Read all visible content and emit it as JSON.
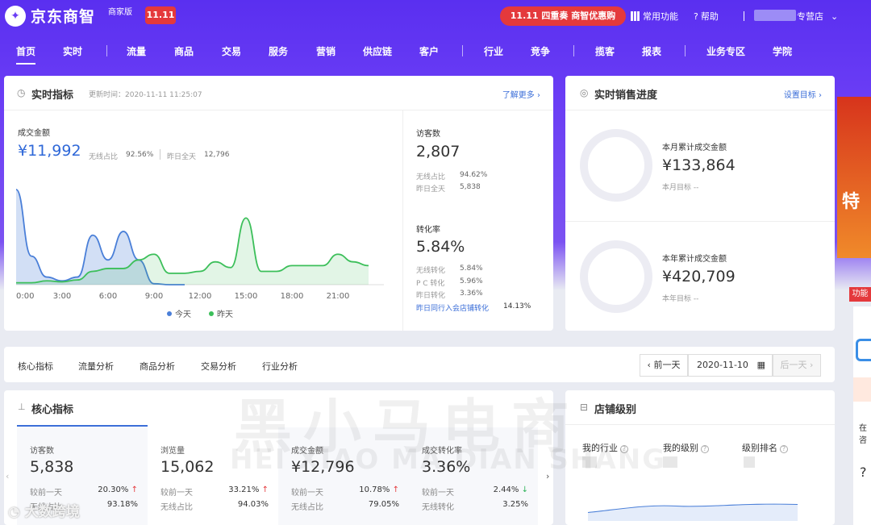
{
  "header": {
    "logo_text": "京东商智",
    "edition": "商家版",
    "badge_1111": "11.11",
    "promo": "11.11 四重奏 商智优惠购",
    "common_functions": "常用功能",
    "help": "帮助",
    "store_suffix": "专营店"
  },
  "nav": {
    "items": [
      "首页",
      "实时",
      "流量",
      "商品",
      "交易",
      "服务",
      "营销",
      "供应链",
      "客户",
      "行业",
      "竞争",
      "揽客",
      "报表",
      "业务专区",
      "学院"
    ]
  },
  "realtime": {
    "title": "实时指标",
    "update_label": "更新时间：2020-11-11 11:25:07",
    "more": "了解更多 ›",
    "gmv_label": "成交金额",
    "gmv_value": "¥11,992",
    "wireless_label": "无线占比",
    "wireless_value": "92.56%",
    "yesterday_label": "昨日全天",
    "yesterday_value": "12,796",
    "visitors_label": "访客数",
    "visitors_value": "2,807",
    "v_wireless_label": "无线占比",
    "v_wireless_value": "94.62%",
    "v_yesterday_label": "昨日全天",
    "v_yesterday_value": "5,838",
    "conv_label": "转化率",
    "conv_value": "5.84%",
    "c_wireless_label": "无线转化",
    "c_wireless_value": "5.84%",
    "c_pc_label": "P C 转化",
    "c_pc_value": "5.96%",
    "c_yesterday_label": "昨日转化",
    "c_yesterday_value": "3.36%",
    "industry_label": "昨日同行入会店铺转化",
    "industry_value": "14.13%"
  },
  "chart_data": {
    "type": "area",
    "x_ticks": [
      "0:00",
      "3:00",
      "6:00",
      "9:00",
      "12:00",
      "15:00",
      "18:00",
      "21:00"
    ],
    "series": [
      {
        "name": "今天",
        "color": "#4a7fd8",
        "x": [
          0,
          1,
          2,
          3,
          4,
          5,
          6,
          7,
          8,
          9,
          10,
          11
        ],
        "y": [
          100,
          30,
          8,
          4,
          8,
          52,
          26,
          56,
          26,
          1,
          0,
          0
        ]
      },
      {
        "name": "昨天",
        "color": "#3cbf5a",
        "x": [
          0,
          1,
          2,
          3,
          4,
          5,
          6,
          7,
          8,
          9,
          10,
          11,
          12,
          13,
          14,
          15,
          16,
          17,
          18,
          19,
          20,
          21,
          22,
          23
        ],
        "y": [
          2,
          2,
          4,
          3,
          5,
          14,
          17,
          17,
          26,
          32,
          12,
          12,
          14,
          24,
          18,
          70,
          14,
          14,
          20,
          20,
          20,
          32,
          24,
          20
        ]
      }
    ],
    "ylim": [
      0,
      100
    ],
    "legend_position": "bottom"
  },
  "sales": {
    "title": "实时销售进度",
    "set_target": "设置目标 ›",
    "month_label": "本月累计成交金额",
    "month_value": "¥133,864",
    "month_target": "本月目标 --",
    "year_label": "本年累计成交金额",
    "year_value": "¥420,709",
    "year_target": "本年目标 --"
  },
  "tabs": {
    "items": [
      "核心指标",
      "流量分析",
      "商品分析",
      "交易分析",
      "行业分析"
    ],
    "prev_day": "‹ 前一天",
    "date": "2020-11-10",
    "next_day": "后一天 ›"
  },
  "core": {
    "title": "核心指标",
    "kpis": [
      {
        "label": "访客数",
        "value": "5,838",
        "r1l": "较前一天",
        "r1v": "20.30%",
        "r1dir": "↑",
        "r2l": "无线占比",
        "r2v": "93.18%"
      },
      {
        "label": "浏览量",
        "value": "15,062",
        "r1l": "较前一天",
        "r1v": "33.21%",
        "r1dir": "↑",
        "r2l": "无线占比",
        "r2v": "94.03%"
      },
      {
        "label": "成交金额",
        "value": "¥12,796",
        "r1l": "较前一天",
        "r1v": "10.78%",
        "r1dir": "↑",
        "r2l": "无线占比",
        "r2v": "79.05%"
      },
      {
        "label": "成交转化率",
        "value": "3.36%",
        "r1l": "较前一天",
        "r1v": "2.44%",
        "r1dir": "↓",
        "r2l": "无线转化",
        "r2v": "3.25%"
      }
    ]
  },
  "level": {
    "title": "店铺级别",
    "my_industry": "我的行业",
    "my_level": "我的级别",
    "rank": "级别排名"
  },
  "side": {
    "special": "特",
    "feature": "功能",
    "consult_1": "在",
    "consult_2": "咨"
  },
  "watermark": {
    "cn": "黑小马电商",
    "en": "HEI XIAO MA DIAN SHANG",
    "bottom": "大数跨境"
  }
}
